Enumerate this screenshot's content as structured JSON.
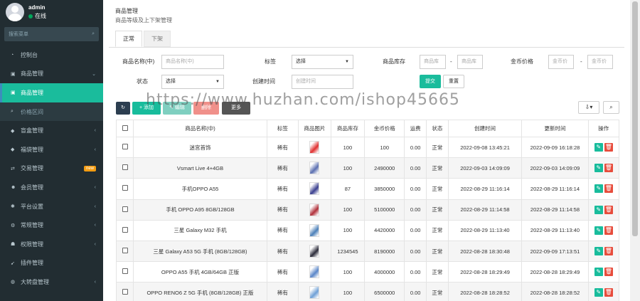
{
  "user": {
    "name": "admin",
    "status": "在线"
  },
  "sidebar": {
    "search_placeholder": "搜索菜单",
    "items": [
      {
        "label": "控制台",
        "icon": "dashboard-icon",
        "arrow": ""
      },
      {
        "label": "商品管理",
        "icon": "bag-icon",
        "arrow": "⌄"
      },
      {
        "label": "商品管理",
        "icon": "bag-icon",
        "arrow": "",
        "active": true
      },
      {
        "label": "价格区间",
        "icon": "search-icon",
        "arrow": "",
        "sub": true
      },
      {
        "label": "盲盒管理",
        "icon": "cube-icon",
        "arrow": "‹"
      },
      {
        "label": "福袋管理",
        "icon": "cube-icon",
        "arrow": "‹"
      },
      {
        "label": "交易管理",
        "icon": "exchange-icon",
        "arrow": "",
        "badge": "new"
      },
      {
        "label": "会员管理",
        "icon": "users-icon",
        "arrow": "‹"
      },
      {
        "label": "平台设置",
        "icon": "cogs-icon",
        "arrow": "‹"
      },
      {
        "label": "常规管理",
        "icon": "gear-icon",
        "arrow": "‹"
      },
      {
        "label": "权限管理",
        "icon": "group-icon",
        "arrow": "‹"
      },
      {
        "label": "插件管理",
        "icon": "rocket-icon",
        "arrow": ""
      },
      {
        "label": "大转盘管理",
        "icon": "globe-icon",
        "arrow": "‹"
      }
    ]
  },
  "page": {
    "title": "商品管理",
    "subtitle": "商品等级及上下架管理"
  },
  "tabs": [
    "正常",
    "下架"
  ],
  "filters": {
    "name_label": "商品名称(中)",
    "name_placeholder": "商品名称(中)",
    "tag_label": "标签",
    "tag_value": "选择",
    "stock_label": "商品库存",
    "stock_min_placeholder": "商品库",
    "stock_max_placeholder": "商品库",
    "price_label": "金币价格",
    "price_min_placeholder": "金币价",
    "price_max_placeholder": "金币价",
    "status_label": "状态",
    "status_value": "选择",
    "created_label": "创建时间",
    "created_placeholder": "创建时间",
    "dash": "-",
    "submit": "提交",
    "reset": "重置"
  },
  "toolbar": {
    "refresh": "↻",
    "add": "+ 添加",
    "edit": "✎ 编辑",
    "delete": "删除",
    "more": "更多",
    "export": "⇩▾",
    "search": "⌕"
  },
  "watermark": "https://www.huzhan.com/ishop45665",
  "table": {
    "headers": [
      "商品名称(中)",
      "标签",
      "商品图片",
      "商品库存",
      "金币价格",
      "运费",
      "状态",
      "创建时间",
      "更新时间",
      "操作"
    ],
    "rows": [
      {
        "name": "迷宫首饰",
        "tag": "稀有",
        "stock": "100",
        "price": "100",
        "ship": "0.00",
        "status": "正常",
        "created": "2022-09-08 13:45:21",
        "updated": "2022-09-09 16:18:28",
        "img": "#e03030"
      },
      {
        "name": "Vsmart Live 4+4GB",
        "tag": "稀有",
        "stock": "100",
        "price": "2490000",
        "ship": "0.00",
        "status": "正常",
        "created": "2022-09-03 14:09:09",
        "updated": "2022-09-03 14:09:09",
        "img": "#5b6fb0"
      },
      {
        "name": "手机OPPO A55",
        "tag": "稀有",
        "stock": "87",
        "price": "3850000",
        "ship": "0.00",
        "status": "正常",
        "created": "2022-08-29 11:16:14",
        "updated": "2022-08-29 11:16:14",
        "img": "#3a3f8f"
      },
      {
        "name": "手机 OPPO A95 8GB/128GB",
        "tag": "稀有",
        "stock": "100",
        "price": "5100000",
        "ship": "0.00",
        "status": "正常",
        "created": "2022-08-29 11:14:58",
        "updated": "2022-08-29 11:14:58",
        "img": "#b0303a"
      },
      {
        "name": "三星 Galaxy M32 手机",
        "tag": "稀有",
        "stock": "100",
        "price": "4420000",
        "ship": "0.00",
        "status": "正常",
        "created": "2022-08-29 11:13:40",
        "updated": "2022-08-29 11:13:40",
        "img": "#4b7fb8"
      },
      {
        "name": "三星 Galaxy A53 5G 手机 (8GB/128GB)",
        "tag": "稀有",
        "stock": "1234545",
        "price": "8190000",
        "ship": "0.00",
        "status": "正常",
        "created": "2022-08-28 18:30:48",
        "updated": "2022-09-09 17:13:51",
        "img": "#2c2c3a"
      },
      {
        "name": "OPPO A55 手机 4GB/64GB 正版",
        "tag": "稀有",
        "stock": "100",
        "price": "4000000",
        "ship": "0.00",
        "status": "正常",
        "created": "2022-08-28 18:29:49",
        "updated": "2022-08-28 18:29:49",
        "img": "#5a86c8"
      },
      {
        "name": "OPPO RENO6 Z 5G 手机 (8GB/128GB) 正版",
        "tag": "稀有",
        "stock": "100",
        "price": "6500000",
        "ship": "0.00",
        "status": "正常",
        "created": "2022-08-28 18:28:52",
        "updated": "2022-08-28 18:28:52",
        "img": "#6fa0d6"
      }
    ]
  },
  "colors": {
    "sidebar_bg": "#222d32",
    "accent": "#1abc9c",
    "danger": "#e74c3c"
  }
}
